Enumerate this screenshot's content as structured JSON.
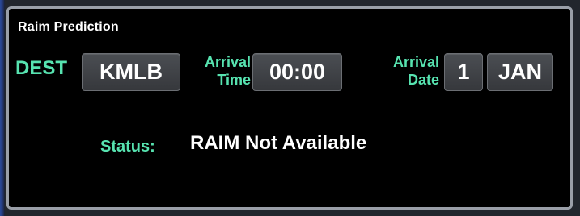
{
  "panel": {
    "title": "Raim Prediction"
  },
  "destination": {
    "label": "DEST",
    "value": "KMLB"
  },
  "arrival_time": {
    "label_line1": "Arrival",
    "label_line2": "Time",
    "value": "00:00"
  },
  "arrival_date": {
    "label_line1": "Arrival",
    "label_line2": "Date",
    "day": "1",
    "month": "JAN"
  },
  "status": {
    "label": "Status:",
    "value": "RAIM Not Available"
  },
  "colors": {
    "label_green": "#57e3b0",
    "value_white": "#ffffff",
    "panel_background": "#000000",
    "button_gray": "#404347",
    "border_gray": "#9a9fa8"
  }
}
